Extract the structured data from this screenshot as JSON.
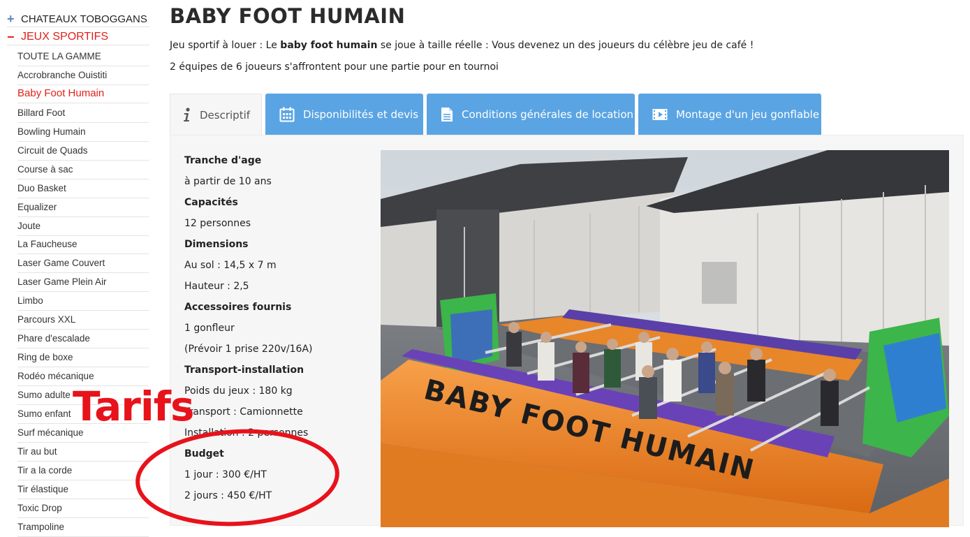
{
  "sidebar": {
    "categories": [
      {
        "symbol": "+",
        "label": "CHATEAUX TOBOGGANS"
      },
      {
        "symbol": "−",
        "label": "JEUX SPORTIFS"
      }
    ],
    "items": [
      "TOUTE LA GAMME",
      "Accrobranche Ouistiti",
      "Baby Foot Humain",
      "Billard Foot",
      "Bowling Humain",
      "Circuit de Quads",
      "Course à sac",
      "Duo Basket",
      "Equalizer",
      "Joute",
      "La Faucheuse",
      "Laser Game Couvert",
      "Laser Game Plein Air",
      "Limbo",
      "Parcours XXL",
      "Phare d'escalade",
      "Ring de boxe",
      "Rodéo mécanique",
      "Sumo adulte",
      "Sumo enfant",
      "Surf mécanique",
      "Tir au but",
      "Tir a la corde",
      "Tir élastique",
      "Toxic Drop",
      "Trampoline"
    ],
    "active_index": 2
  },
  "page": {
    "title": "BABY FOOT HUMAIN",
    "intro_before": "Jeu sportif à louer : Le ",
    "intro_bold": "baby foot humain",
    "intro_after": " se joue à taille réelle : Vous devenez un des joueurs du célèbre jeu de café !",
    "intro_line2": "2 équipes de 6 joueurs s'affrontent pour une partie pour en tournoi"
  },
  "tabs": [
    {
      "label": "Descriptif",
      "icon": "info-icon"
    },
    {
      "label": "Disponibilités et devis",
      "icon": "calendar-icon"
    },
    {
      "label": "Conditions générales de location",
      "icon": "document-icon"
    },
    {
      "label": "Montage d'un jeu gonflable",
      "icon": "video-icon"
    }
  ],
  "specs": [
    {
      "heading": "Tranche d'age"
    },
    {
      "text": "à partir de 10 ans"
    },
    {
      "heading": "Capacités"
    },
    {
      "text": "12 personnes"
    },
    {
      "heading": "Dimensions"
    },
    {
      "text": "Au sol : 14,5 x 7 m"
    },
    {
      "text": "Hauteur : 2,5"
    },
    {
      "heading": "Accessoires fournis"
    },
    {
      "text": "1 gonfleur"
    },
    {
      "text": "(Prévoir 1 prise 220v/16A)"
    },
    {
      "heading": "Transport-installation"
    },
    {
      "text": "Poids du jeux : 180 kg"
    },
    {
      "text": "Transport : Camionnette"
    },
    {
      "text": "Installation : 2 personnes"
    },
    {
      "heading": "Budget"
    },
    {
      "text": "1 jour : 300 €/HT"
    },
    {
      "text": "2 jours : 450 €/HT"
    }
  ],
  "annotation": {
    "text": "Tarifs",
    "color": "#e8121b"
  },
  "photo": {
    "banner_text": "BABY FOOT HUMAIN"
  },
  "colors": {
    "accent_red": "#e0221a",
    "tab_blue": "#5aa4e3",
    "plus_blue": "#5b87c5"
  }
}
